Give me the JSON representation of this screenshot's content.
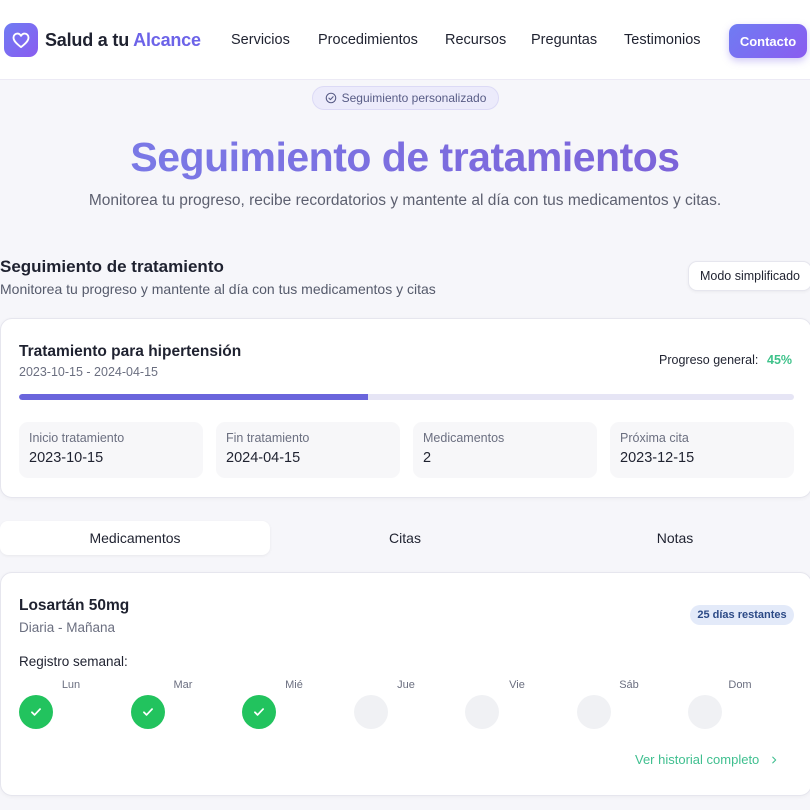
{
  "brand": {
    "name_part1": "Salud a tu ",
    "name_part2": "Alcance",
    "logo_icon": "heart-icon"
  },
  "nav": {
    "links": [
      "Servicios",
      "Procedimientos",
      "Recursos",
      "Preguntas",
      "Testimonios"
    ],
    "contact_label": "Contacto"
  },
  "hero": {
    "badge": "Seguimiento personalizado",
    "title": "Seguimiento de tratamientos",
    "subtitle": "Monitorea tu progreso, recibe recordatorios y mantente al día con tus medicamentos y citas."
  },
  "section": {
    "title": "Seguimiento de tratamiento",
    "subtitle": "Monitorea tu progreso y mantente al día con tus medicamentos y citas",
    "simple_mode_label": "Modo simplificado"
  },
  "treatment": {
    "title": "Tratamiento para hipertensión",
    "dates": "2023-10-15 - 2024-04-15",
    "progress_label": "Progreso general:",
    "progress_text": "45%",
    "progress_fraction": 0.45,
    "stats": [
      {
        "label": "Inicio tratamiento",
        "value": "2023-10-15"
      },
      {
        "label": "Fin tratamiento",
        "value": "2024-04-15"
      },
      {
        "label": "Medicamentos",
        "value": "2"
      },
      {
        "label": "Próxima cita",
        "value": "2023-12-15"
      }
    ]
  },
  "tabs": [
    "Medicamentos",
    "Citas",
    "Notas"
  ],
  "medication": {
    "name": "Losartán 50mg",
    "frequency": "Diaria - Mañana",
    "remaining": "25 días restantes",
    "weekly_label": "Registro semanal:",
    "days": [
      {
        "name": "Lun",
        "taken": true
      },
      {
        "name": "Mar",
        "taken": true
      },
      {
        "name": "Mié",
        "taken": true
      },
      {
        "name": "Jue",
        "taken": false
      },
      {
        "name": "Vie",
        "taken": false
      },
      {
        "name": "Sáb",
        "taken": false
      },
      {
        "name": "Dom",
        "taken": false
      }
    ],
    "history_link": "Ver historial completo"
  },
  "colors": {
    "accent": "#6c63e8",
    "success": "#22c35e",
    "progress_text": "#3ec28a"
  }
}
